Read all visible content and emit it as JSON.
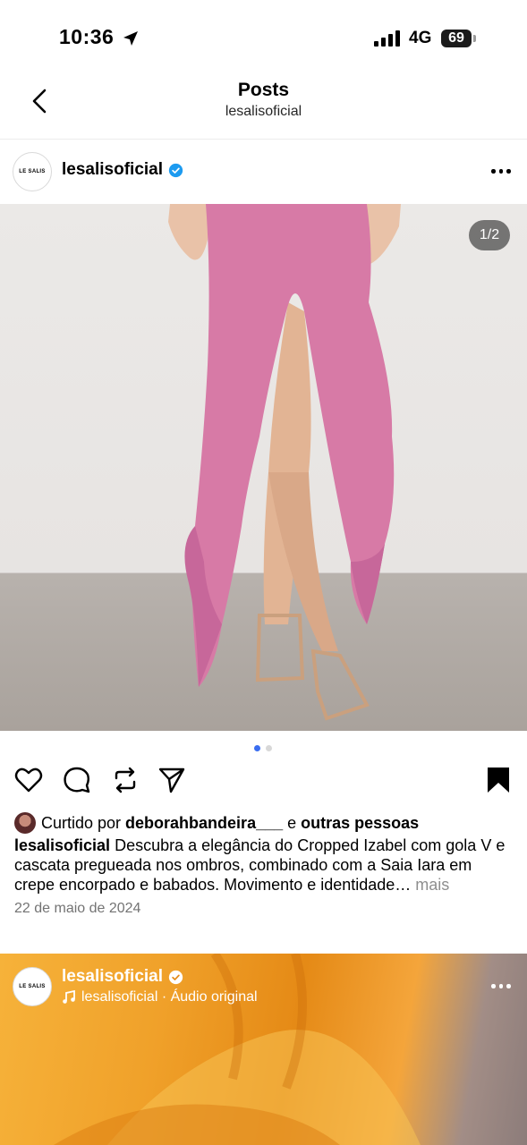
{
  "status_bar": {
    "time": "10:36",
    "network": "4G",
    "battery": "69"
  },
  "header": {
    "title": "Posts",
    "subtitle": "lesalisoficial"
  },
  "post": {
    "avatar_text": "LE SALIS",
    "username": "lesalisoficial",
    "image_counter": "1/2",
    "liked_by_prefix": "Curtido por ",
    "liked_by_user": "deborahbandeira___",
    "liked_by_mid": " e ",
    "liked_by_others": "outras pessoas",
    "caption_user": "lesalisoficial",
    "caption_text": " Descubra a elegância do Cropped Izabel com gola V e cascata pregueada nos ombros, combinado com a Saia Iara em crepe encorpado e babados. Movimento e identidade…",
    "caption_more": " mais",
    "date": "22 de maio de 2024"
  },
  "next_post": {
    "avatar_text": "LE SALIS",
    "username": "lesalisoficial",
    "audio": "lesalisoficial · Áudio original"
  },
  "colors": {
    "verified": "#1d9bf0",
    "dot_active": "#3a6df0",
    "dot_inactive": "#d8d8d8",
    "dress_pink": "#d77aa6"
  }
}
